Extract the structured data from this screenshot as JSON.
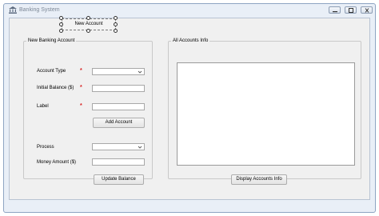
{
  "window": {
    "title": "Banking System"
  },
  "toolbar": {
    "new_account_label": "New Account"
  },
  "new_account_group": {
    "title": "New Banking Account",
    "account_type_label": "Account Type",
    "initial_balance_label": "Initial Balance ($)",
    "label_label": "Label",
    "required_marker": "*",
    "add_account_label": "Add Account",
    "process_label": "Process",
    "money_amount_label": "Money Amount ($)",
    "update_balance_label": "Update Balance",
    "account_type_value": "",
    "initial_balance_value": "",
    "label_value": "",
    "process_value": "",
    "money_amount_value": ""
  },
  "accounts_group": {
    "title": "All Accounts Info",
    "display_label": "Display Accounts Info",
    "items": []
  },
  "icons": {
    "app": "bank-icon",
    "minimize": "minimize-icon",
    "maximize": "maximize-icon",
    "close": "close-icon",
    "dropdown": "chevron-down-icon"
  },
  "colors": {
    "window_frame": "#e9eff7",
    "client_bg": "#f0f0f0",
    "required": "#d81e1e"
  }
}
